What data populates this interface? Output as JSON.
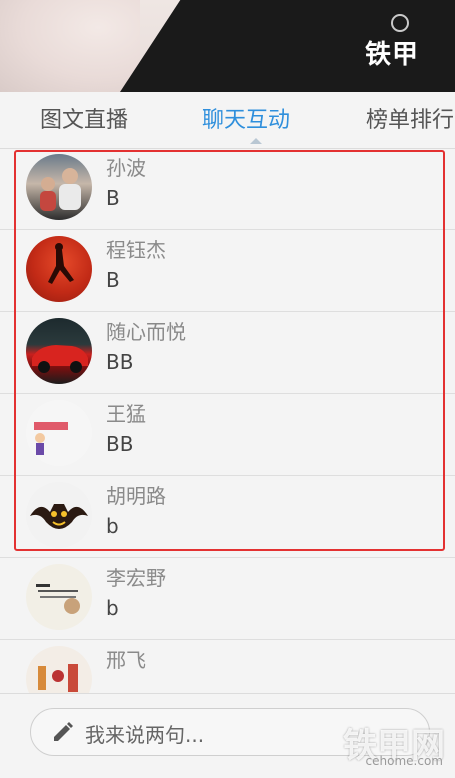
{
  "banner": {
    "watermark": "铁甲"
  },
  "tabs": [
    {
      "label": "图文直播",
      "active": false
    },
    {
      "label": "聊天互动",
      "active": true
    },
    {
      "label": "榜单排行",
      "active": false
    }
  ],
  "chat": [
    {
      "name": "孙波",
      "message": "B"
    },
    {
      "name": "程钰杰",
      "message": "B"
    },
    {
      "name": "随心而悦",
      "message": "BB"
    },
    {
      "name": "王猛",
      "message": "BB"
    },
    {
      "name": "胡明路",
      "message": "b"
    },
    {
      "name": "李宏野",
      "message": "b"
    },
    {
      "name": "邢飞",
      "message": ""
    }
  ],
  "composer": {
    "placeholder": "我来说两句..."
  },
  "site": {
    "watermark": "铁甲网",
    "url": "cehome.com"
  },
  "colors": {
    "active_tab": "#2f8fdc",
    "highlight_border": "#e33131"
  }
}
